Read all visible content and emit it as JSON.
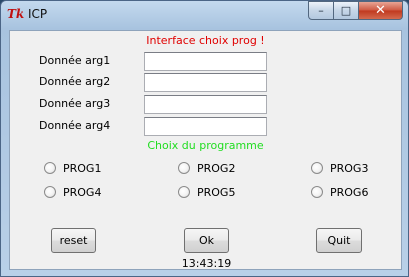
{
  "window": {
    "icon_glyph": "Tk",
    "title": "ICP",
    "controls": {
      "minimize": "–",
      "maximize": "□",
      "close": "✕"
    }
  },
  "form": {
    "heading": "Interface choix prog !",
    "args": [
      {
        "label": "Donnée arg1",
        "value": ""
      },
      {
        "label": "Donnée arg2",
        "value": ""
      },
      {
        "label": "Donnée arg3",
        "value": ""
      },
      {
        "label": "Donnée arg4",
        "value": ""
      }
    ],
    "program_heading": "Choix du programme",
    "programs": [
      {
        "label": "PROG1",
        "selected": false
      },
      {
        "label": "PROG2",
        "selected": false
      },
      {
        "label": "PROG3",
        "selected": false
      },
      {
        "label": "PROG4",
        "selected": false
      },
      {
        "label": "PROG5",
        "selected": false
      },
      {
        "label": "PROG6",
        "selected": false
      }
    ]
  },
  "buttons": {
    "reset": "reset",
    "ok": "Ok",
    "quit": "Quit"
  },
  "clock": "13:43:19",
  "colors": {
    "heading": "#e00000",
    "program_heading": "#22dd22",
    "title_bar": "#a8c3df",
    "close_button": "#c0391f"
  }
}
